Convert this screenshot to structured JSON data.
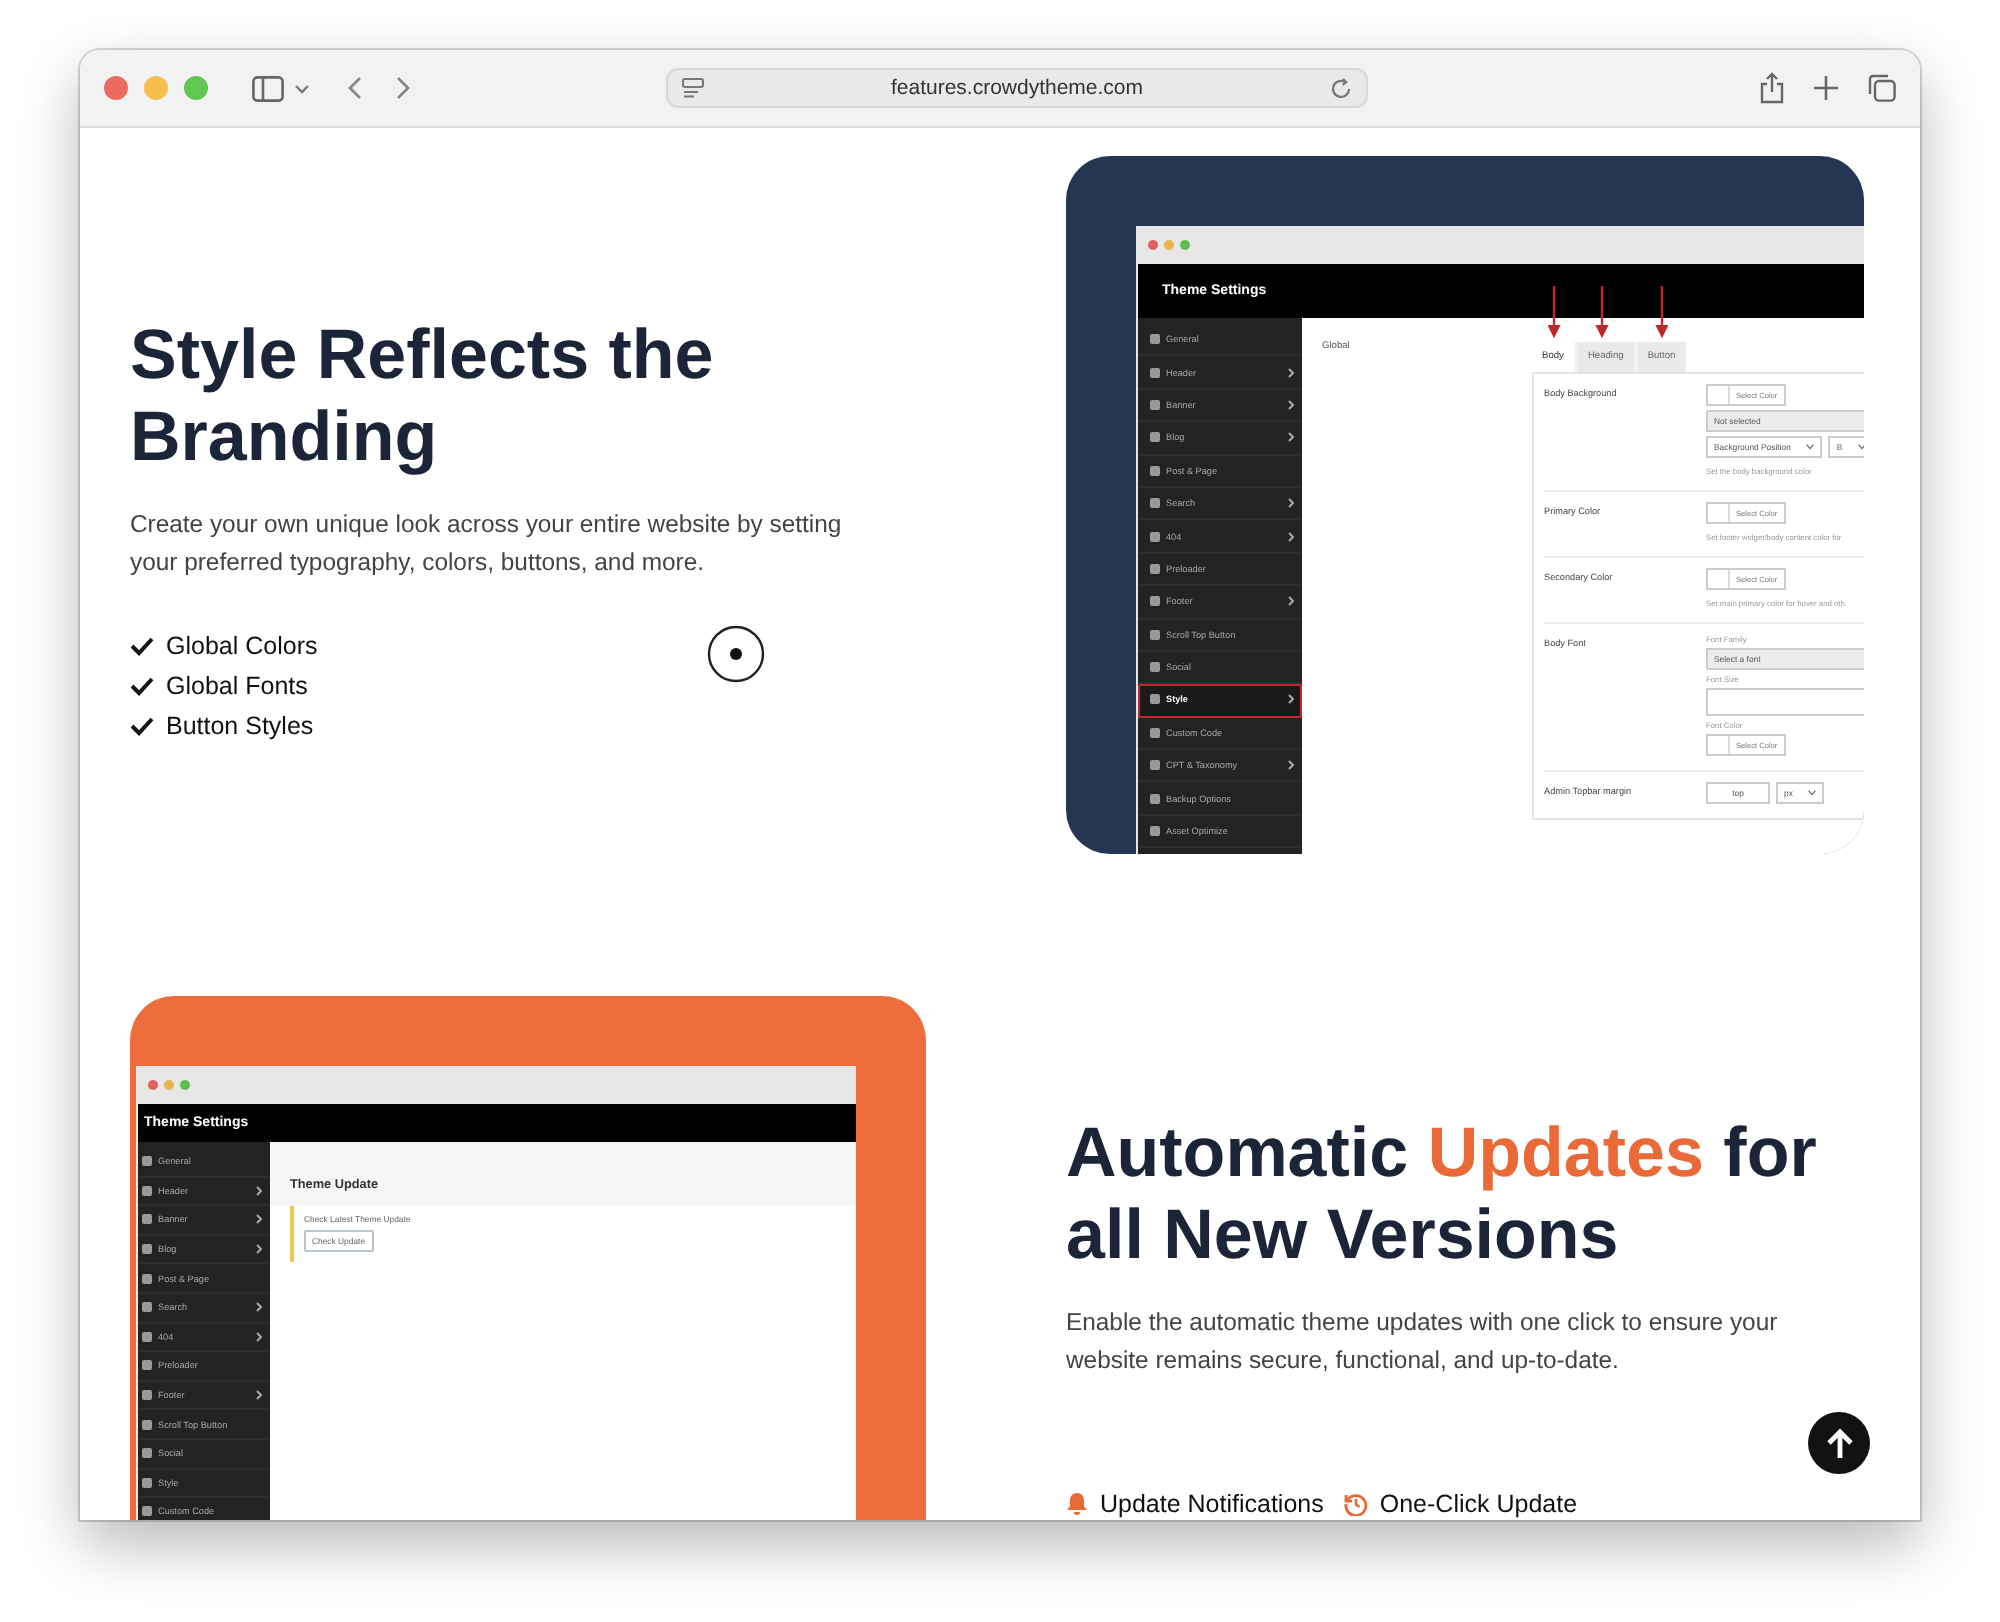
{
  "browser": {
    "url": "features.crowdytheme.com"
  },
  "style_section": {
    "title_lines": [
      "Style Reflects the",
      "Branding"
    ],
    "description": "Create your own unique look across your entire website by setting your preferred typography, colors, buttons, and more.",
    "features": [
      {
        "label": "Global Colors"
      },
      {
        "label": "Global Fonts"
      },
      {
        "label": "Button Styles"
      }
    ],
    "preview": {
      "title": "Theme Settings",
      "sidebar": [
        {
          "label": "General",
          "submenu": false,
          "selected": false
        },
        {
          "label": "Header",
          "submenu": true,
          "selected": false
        },
        {
          "label": "Banner",
          "submenu": true,
          "selected": false
        },
        {
          "label": "Blog",
          "submenu": true,
          "selected": false
        },
        {
          "label": "Post & Page",
          "submenu": false,
          "selected": false
        },
        {
          "label": "Search",
          "submenu": true,
          "selected": false
        },
        {
          "label": "404",
          "submenu": true,
          "selected": false
        },
        {
          "label": "Preloader",
          "submenu": false,
          "selected": false
        },
        {
          "label": "Footer",
          "submenu": true,
          "selected": false
        },
        {
          "label": "Scroll Top Button",
          "submenu": false,
          "selected": false
        },
        {
          "label": "Social",
          "submenu": false,
          "selected": false
        },
        {
          "label": "Style",
          "submenu": true,
          "selected": true
        },
        {
          "label": "Custom Code",
          "submenu": false,
          "selected": false
        },
        {
          "label": "CPT & Taxonomy",
          "submenu": true,
          "selected": false
        },
        {
          "label": "Backup Options",
          "submenu": false,
          "selected": false
        },
        {
          "label": "Asset Optimize",
          "submenu": false,
          "selected": false
        }
      ],
      "section_label": "Global",
      "tabs": [
        {
          "label": "Body",
          "selected": true
        },
        {
          "label": "Heading",
          "selected": false
        },
        {
          "label": "Button",
          "selected": false
        }
      ],
      "rows": [
        {
          "label": "Body Background",
          "controls": [
            {
              "kind": "color",
              "text": "Select Color"
            },
            {
              "kind": "select",
              "text": "Not selected"
            },
            {
              "kind": "group",
              "items": [
                {
                  "kind": "select",
                  "text": "Background Position"
                },
                {
                  "kind": "select",
                  "text": "B"
                }
              ]
            },
            {
              "kind": "hint",
              "text": "Set the body background color"
            }
          ]
        },
        {
          "label": "Primary Color",
          "controls": [
            {
              "kind": "color",
              "text": "Select Color"
            },
            {
              "kind": "hint",
              "text": "Set footer widget/body content color for"
            }
          ]
        },
        {
          "label": "Secondary Color",
          "controls": [
            {
              "kind": "color",
              "text": "Select Color"
            },
            {
              "kind": "hint",
              "text": "Set main primary color for hover and oth"
            }
          ]
        },
        {
          "label": "Body Font",
          "controls": [
            {
              "kind": "caption",
              "text": "Font Family"
            },
            {
              "kind": "select",
              "text": "Select a font"
            },
            {
              "kind": "caption",
              "text": "Font Size"
            },
            {
              "kind": "input"
            },
            {
              "kind": "caption",
              "text": "Font Color"
            },
            {
              "kind": "color",
              "text": "Select Color"
            }
          ]
        },
        {
          "label": "Admin Topbar margin",
          "controls": [
            {
              "kind": "group",
              "items": [
                {
                  "kind": "input",
                  "text": "top"
                },
                {
                  "kind": "select",
                  "text": "px"
                }
              ]
            }
          ]
        }
      ]
    }
  },
  "updates_section": {
    "title_lines": [
      [
        {
          "text": "Automatic ",
          "accent": false
        },
        {
          "text": "Updates",
          "accent": true
        },
        {
          "text": " for",
          "accent": false
        }
      ],
      [
        {
          "text": "all New Versions",
          "accent": false
        }
      ]
    ],
    "description": "Enable the automatic theme updates with one click to ensure your website remains secure, functional, and up-to-date.",
    "features": [
      {
        "label": "Update Notifications",
        "kind": "bell"
      },
      {
        "label": "One-Click Update",
        "kind": "history"
      }
    ],
    "preview": {
      "title": "Theme Settings",
      "sidebar": [
        {
          "label": "General",
          "submenu": false
        },
        {
          "label": "Header",
          "submenu": true
        },
        {
          "label": "Banner",
          "submenu": true
        },
        {
          "label": "Blog",
          "submenu": true
        },
        {
          "label": "Post & Page",
          "submenu": false
        },
        {
          "label": "Search",
          "submenu": true
        },
        {
          "label": "404",
          "submenu": true
        },
        {
          "label": "Preloader",
          "submenu": false
        },
        {
          "label": "Footer",
          "submenu": true
        },
        {
          "label": "Scroll Top Button",
          "submenu": false
        },
        {
          "label": "Social",
          "submenu": false
        },
        {
          "label": "Style",
          "submenu": false
        },
        {
          "label": "Custom Code",
          "submenu": false
        }
      ],
      "heading": "Theme Update",
      "notice": "Check Latest Theme Update",
      "button": "Check Update"
    }
  }
}
